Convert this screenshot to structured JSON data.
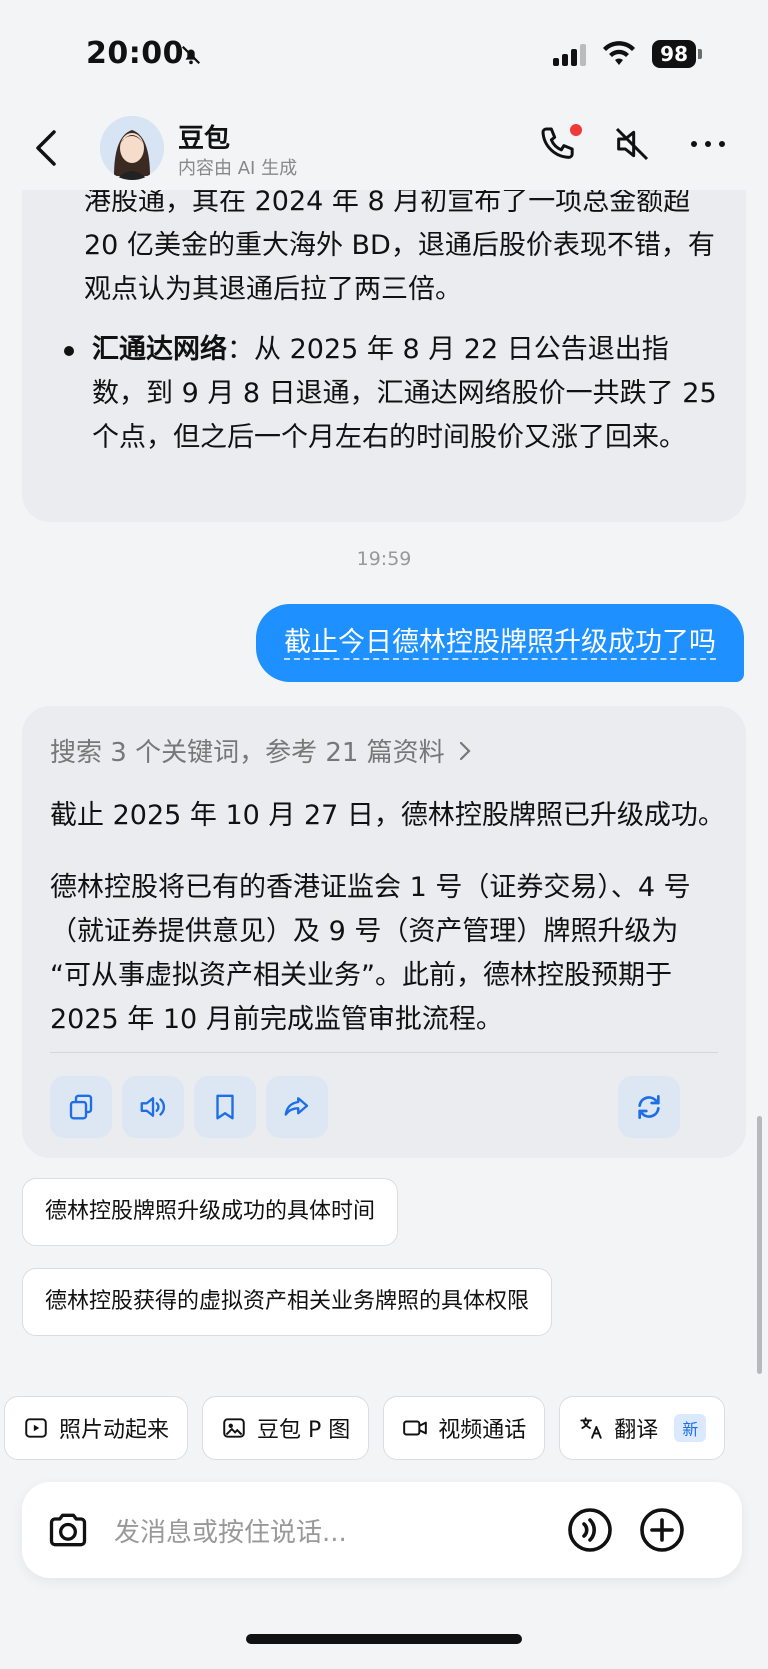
{
  "status_bar": {
    "time": "20:00",
    "battery": "98"
  },
  "header": {
    "name": "豆包",
    "subtitle": "内容由 AI 生成"
  },
  "previous_answer": {
    "para_continuation": "港股通，其在 2024 年 8 月初宣布了一项总金额超 20 亿美金的重大海外 BD，退通后股价表现不错，有观点认为其退通后拉了两三倍。",
    "bullet_bold": "汇通达网络",
    "bullet_text": "：从 2025 年 8 月 22 日公告退出指数，到 9 月 8 日退通，汇通达网络股价一共跌了 25 个点，但之后一个月左右的时间股价又涨了回来。"
  },
  "timestamp": "19:59",
  "user_message": "截止今日德林控股牌照升级成功了吗",
  "answer": {
    "search_summary": "搜索 3 个关键词，参考 21 篇资料",
    "paragraph1": "截止 2025 年 10 月 27 日，德林控股牌照已升级成功。",
    "paragraph2": "德林控股将已有的香港证监会 1 号（证券交易）、4 号（就证券提供意见）及 9 号（资产管理）牌照升级为 “可从事虚拟资产相关业务”。此前，德林控股预期于 2025 年 10 月前完成监管审批流程。"
  },
  "suggestions": [
    "德林控股牌照升级成功的具体时间",
    "德林控股获得的虚拟资产相关业务牌照的具体权限"
  ],
  "chips": [
    {
      "label": "照片动起来"
    },
    {
      "label": "豆包 P 图"
    },
    {
      "label": "视频通话"
    },
    {
      "label": "翻译",
      "badge": "新"
    }
  ],
  "input": {
    "placeholder": "发消息或按住说话..."
  },
  "colors": {
    "accent": "#1e90ff",
    "card_bg": "#ebecef"
  }
}
